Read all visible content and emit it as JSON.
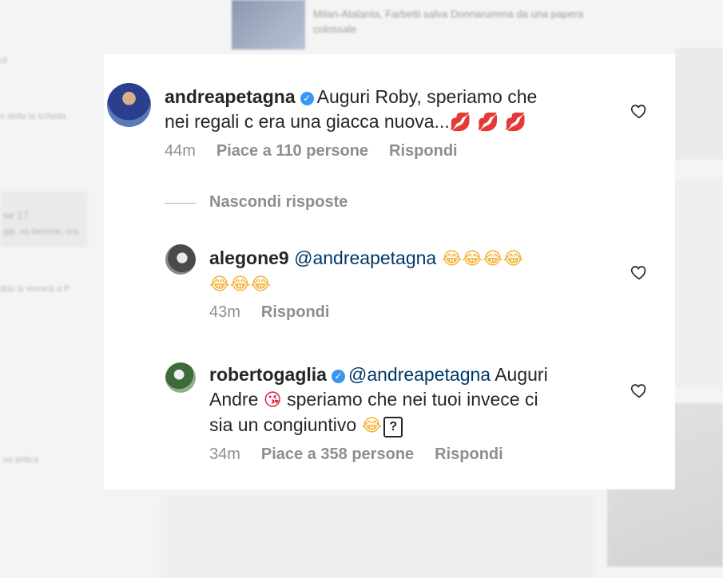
{
  "background": {
    "headline_line1": "Milan-Atalanta, Farbetti salva Donnarumma da una papera",
    "headline_line2": "colossale",
    "snippets": [
      "ol",
      "n della la scheda",
      "se 17",
      "ggi, va benone, ora",
      "ddo si vincerà a P",
      "va antica"
    ]
  },
  "comments": [
    {
      "username": "andreapetagna",
      "verified": true,
      "text_line1": "Auguri Roby, speriamo che",
      "text_line2": "nei regali c era una giacca nuova...",
      "emojis": "💋 💋 💋",
      "time": "44m",
      "likes": "Piace a 110 persone",
      "reply": "Rispondi"
    },
    {
      "username": "alegone9",
      "mention": "@andreapetagna",
      "emojis_line1": "😂😂😂😂",
      "emojis_line2": "😂😂😂",
      "time": "43m",
      "reply": "Rispondi"
    },
    {
      "username": "robertogaglia",
      "verified": true,
      "mention": "@andreapetagna",
      "text_part1": "Auguri",
      "text_part2": "Andre",
      "kiss_emoji": "😘",
      "text_part3": "speriamo che nei tuoi invece ci",
      "text_part4": "sia un congiuntivo",
      "laugh_emoji": "😂",
      "unknown_glyph": "?",
      "time": "34m",
      "likes": "Piace a 358 persone",
      "reply": "Rispondi"
    }
  ],
  "hide_replies": "Nascondi risposte",
  "icons": {
    "verified": "verified-badge-icon",
    "heart": "heart-outline-icon"
  },
  "colors": {
    "username": "#262626",
    "mention": "#00376b",
    "meta": "#8e8e8e",
    "verified": "#3897f0"
  }
}
